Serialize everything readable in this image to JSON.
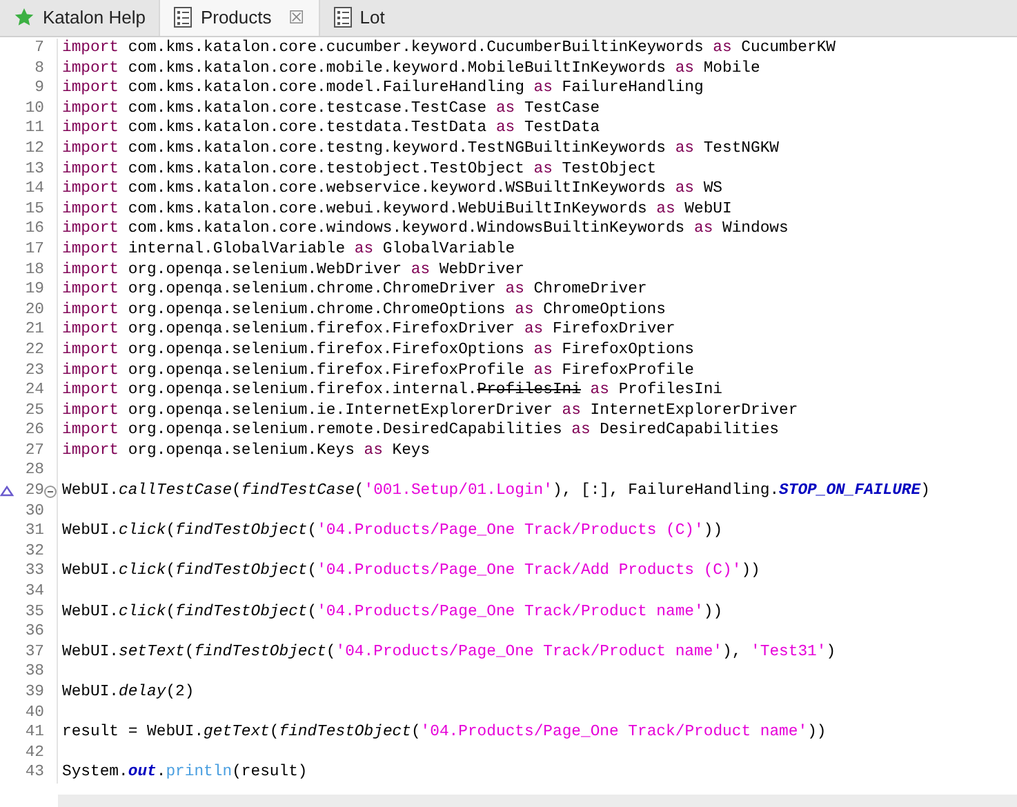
{
  "tabs": [
    {
      "label": "Katalon Help",
      "kind": "help",
      "selected": false,
      "closable": false
    },
    {
      "label": "Products",
      "kind": "document",
      "selected": true,
      "closable": true
    },
    {
      "label": "Lot",
      "kind": "document",
      "selected": false,
      "closable": false
    }
  ],
  "close_glyph": "☒",
  "editor": {
    "lines": [
      {
        "number": "7",
        "segments": [
          {
            "kind": "keyword",
            "text": "import"
          },
          {
            "kind": "plain",
            "text": " com.kms.katalon.core.cucumber.keyword.CucumberBuiltinKeywords "
          },
          {
            "kind": "keyword",
            "text": "as"
          },
          {
            "kind": "plain",
            "text": " CucumberKW"
          }
        ]
      },
      {
        "number": "8",
        "segments": [
          {
            "kind": "keyword",
            "text": "import"
          },
          {
            "kind": "plain",
            "text": " com.kms.katalon.core.mobile.keyword.MobileBuiltInKeywords "
          },
          {
            "kind": "keyword",
            "text": "as"
          },
          {
            "kind": "plain",
            "text": " Mobile"
          }
        ]
      },
      {
        "number": "9",
        "segments": [
          {
            "kind": "keyword",
            "text": "import"
          },
          {
            "kind": "plain",
            "text": " com.kms.katalon.core.model.FailureHandling "
          },
          {
            "kind": "keyword",
            "text": "as"
          },
          {
            "kind": "plain",
            "text": " FailureHandling"
          }
        ]
      },
      {
        "number": "10",
        "segments": [
          {
            "kind": "keyword",
            "text": "import"
          },
          {
            "kind": "plain",
            "text": " com.kms.katalon.core.testcase.TestCase "
          },
          {
            "kind": "keyword",
            "text": "as"
          },
          {
            "kind": "plain",
            "text": " TestCase"
          }
        ]
      },
      {
        "number": "11",
        "segments": [
          {
            "kind": "keyword",
            "text": "import"
          },
          {
            "kind": "plain",
            "text": " com.kms.katalon.core.testdata.TestData "
          },
          {
            "kind": "keyword",
            "text": "as"
          },
          {
            "kind": "plain",
            "text": " TestData"
          }
        ]
      },
      {
        "number": "12",
        "segments": [
          {
            "kind": "keyword",
            "text": "import"
          },
          {
            "kind": "plain",
            "text": " com.kms.katalon.core.testng.keyword.TestNGBuiltinKeywords "
          },
          {
            "kind": "keyword",
            "text": "as"
          },
          {
            "kind": "plain",
            "text": " TestNGKW"
          }
        ]
      },
      {
        "number": "13",
        "segments": [
          {
            "kind": "keyword",
            "text": "import"
          },
          {
            "kind": "plain",
            "text": " com.kms.katalon.core.testobject.TestObject "
          },
          {
            "kind": "keyword",
            "text": "as"
          },
          {
            "kind": "plain",
            "text": " TestObject"
          }
        ]
      },
      {
        "number": "14",
        "segments": [
          {
            "kind": "keyword",
            "text": "import"
          },
          {
            "kind": "plain",
            "text": " com.kms.katalon.core.webservice.keyword.WSBuiltInKeywords "
          },
          {
            "kind": "keyword",
            "text": "as"
          },
          {
            "kind": "plain",
            "text": " WS"
          }
        ]
      },
      {
        "number": "15",
        "segments": [
          {
            "kind": "keyword",
            "text": "import"
          },
          {
            "kind": "plain",
            "text": " com.kms.katalon.core.webui.keyword.WebUiBuiltInKeywords "
          },
          {
            "kind": "keyword",
            "text": "as"
          },
          {
            "kind": "plain",
            "text": " WebUI"
          }
        ]
      },
      {
        "number": "16",
        "segments": [
          {
            "kind": "keyword",
            "text": "import"
          },
          {
            "kind": "plain",
            "text": " com.kms.katalon.core.windows.keyword.WindowsBuiltinKeywords "
          },
          {
            "kind": "keyword",
            "text": "as"
          },
          {
            "kind": "plain",
            "text": " Windows"
          }
        ]
      },
      {
        "number": "17",
        "segments": [
          {
            "kind": "keyword",
            "text": "import"
          },
          {
            "kind": "plain",
            "text": " internal.GlobalVariable "
          },
          {
            "kind": "keyword",
            "text": "as"
          },
          {
            "kind": "plain",
            "text": " GlobalVariable"
          }
        ]
      },
      {
        "number": "18",
        "segments": [
          {
            "kind": "keyword",
            "text": "import"
          },
          {
            "kind": "plain",
            "text": " org.openqa.selenium.WebDriver "
          },
          {
            "kind": "keyword",
            "text": "as"
          },
          {
            "kind": "plain",
            "text": " WebDriver"
          }
        ]
      },
      {
        "number": "19",
        "segments": [
          {
            "kind": "keyword",
            "text": "import"
          },
          {
            "kind": "plain",
            "text": " org.openqa.selenium.chrome.ChromeDriver "
          },
          {
            "kind": "keyword",
            "text": "as"
          },
          {
            "kind": "plain",
            "text": " ChromeDriver"
          }
        ]
      },
      {
        "number": "20",
        "segments": [
          {
            "kind": "keyword",
            "text": "import"
          },
          {
            "kind": "plain",
            "text": " org.openqa.selenium.chrome.ChromeOptions "
          },
          {
            "kind": "keyword",
            "text": "as"
          },
          {
            "kind": "plain",
            "text": " ChromeOptions"
          }
        ]
      },
      {
        "number": "21",
        "segments": [
          {
            "kind": "keyword",
            "text": "import"
          },
          {
            "kind": "plain",
            "text": " org.openqa.selenium.firefox.FirefoxDriver "
          },
          {
            "kind": "keyword",
            "text": "as"
          },
          {
            "kind": "plain",
            "text": " FirefoxDriver"
          }
        ]
      },
      {
        "number": "22",
        "segments": [
          {
            "kind": "keyword",
            "text": "import"
          },
          {
            "kind": "plain",
            "text": " org.openqa.selenium.firefox.FirefoxOptions "
          },
          {
            "kind": "keyword",
            "text": "as"
          },
          {
            "kind": "plain",
            "text": " FirefoxOptions"
          }
        ]
      },
      {
        "number": "23",
        "segments": [
          {
            "kind": "keyword",
            "text": "import"
          },
          {
            "kind": "plain",
            "text": " org.openqa.selenium.firefox.FirefoxProfile "
          },
          {
            "kind": "keyword",
            "text": "as"
          },
          {
            "kind": "plain",
            "text": " FirefoxProfile"
          }
        ]
      },
      {
        "number": "24",
        "segments": [
          {
            "kind": "keyword",
            "text": "import"
          },
          {
            "kind": "plain",
            "text": " org.openqa.selenium.firefox.internal."
          },
          {
            "kind": "deprecated",
            "text": "ProfilesIni"
          },
          {
            "kind": "keyword",
            "text": " as"
          },
          {
            "kind": "plain",
            "text": " ProfilesIni"
          }
        ]
      },
      {
        "number": "25",
        "segments": [
          {
            "kind": "keyword",
            "text": "import"
          },
          {
            "kind": "plain",
            "text": " org.openqa.selenium.ie.InternetExplorerDriver "
          },
          {
            "kind": "keyword",
            "text": "as"
          },
          {
            "kind": "plain",
            "text": " InternetExplorerDriver"
          }
        ]
      },
      {
        "number": "26",
        "segments": [
          {
            "kind": "keyword",
            "text": "import"
          },
          {
            "kind": "plain",
            "text": " org.openqa.selenium.remote.DesiredCapabilities "
          },
          {
            "kind": "keyword",
            "text": "as"
          },
          {
            "kind": "plain",
            "text": " DesiredCapabilities"
          }
        ]
      },
      {
        "number": "27",
        "segments": [
          {
            "kind": "keyword",
            "text": "import"
          },
          {
            "kind": "plain",
            "text": " org.openqa.selenium.Keys "
          },
          {
            "kind": "keyword",
            "text": "as"
          },
          {
            "kind": "plain",
            "text": " Keys"
          }
        ]
      },
      {
        "number": "28"
      },
      {
        "number": "29",
        "override_marker": true,
        "fold_expanded": true,
        "segments": [
          {
            "kind": "plain",
            "text": "WebUI."
          },
          {
            "kind": "method",
            "text": "callTestCase"
          },
          {
            "kind": "plain",
            "text": "("
          },
          {
            "kind": "method",
            "text": "findTestCase"
          },
          {
            "kind": "plain",
            "text": "("
          },
          {
            "kind": "string",
            "text": "'001.Setup/01.Login'"
          },
          {
            "kind": "plain",
            "text": "), [:], FailureHandling."
          },
          {
            "kind": "constant",
            "text": "STOP_ON_FAILURE"
          },
          {
            "kind": "plain",
            "text": ")"
          }
        ]
      },
      {
        "number": "30"
      },
      {
        "number": "31",
        "segments": [
          {
            "kind": "plain",
            "text": "WebUI."
          },
          {
            "kind": "method",
            "text": "click"
          },
          {
            "kind": "plain",
            "text": "("
          },
          {
            "kind": "method",
            "text": "findTestObject"
          },
          {
            "kind": "plain",
            "text": "("
          },
          {
            "kind": "string",
            "text": "'04.Products/Page_One Track/Products (C)'"
          },
          {
            "kind": "plain",
            "text": "))"
          }
        ]
      },
      {
        "number": "32"
      },
      {
        "number": "33",
        "segments": [
          {
            "kind": "plain",
            "text": "WebUI."
          },
          {
            "kind": "method",
            "text": "click"
          },
          {
            "kind": "plain",
            "text": "("
          },
          {
            "kind": "method",
            "text": "findTestObject"
          },
          {
            "kind": "plain",
            "text": "("
          },
          {
            "kind": "string",
            "text": "'04.Products/Page_One Track/Add Products (C)'"
          },
          {
            "kind": "plain",
            "text": "))"
          }
        ]
      },
      {
        "number": "34"
      },
      {
        "number": "35",
        "segments": [
          {
            "kind": "plain",
            "text": "WebUI."
          },
          {
            "kind": "method",
            "text": "click"
          },
          {
            "kind": "plain",
            "text": "("
          },
          {
            "kind": "method",
            "text": "findTestObject"
          },
          {
            "kind": "plain",
            "text": "("
          },
          {
            "kind": "string",
            "text": "'04.Products/Page_One Track/Product name'"
          },
          {
            "kind": "plain",
            "text": "))"
          }
        ]
      },
      {
        "number": "36"
      },
      {
        "number": "37",
        "segments": [
          {
            "kind": "plain",
            "text": "WebUI."
          },
          {
            "kind": "method",
            "text": "setText"
          },
          {
            "kind": "plain",
            "text": "("
          },
          {
            "kind": "method",
            "text": "findTestObject"
          },
          {
            "kind": "plain",
            "text": "("
          },
          {
            "kind": "string",
            "text": "'04.Products/Page_One Track/Product name'"
          },
          {
            "kind": "plain",
            "text": "), "
          },
          {
            "kind": "string",
            "text": "'Test31'"
          },
          {
            "kind": "plain",
            "text": ")"
          }
        ]
      },
      {
        "number": "38"
      },
      {
        "number": "39",
        "segments": [
          {
            "kind": "plain",
            "text": "WebUI."
          },
          {
            "kind": "method",
            "text": "delay"
          },
          {
            "kind": "plain",
            "text": "(2)"
          }
        ]
      },
      {
        "number": "40"
      },
      {
        "number": "41",
        "segments": [
          {
            "kind": "plain",
            "text": "result = WebUI."
          },
          {
            "kind": "method",
            "text": "getText"
          },
          {
            "kind": "plain",
            "text": "("
          },
          {
            "kind": "method",
            "text": "findTestObject"
          },
          {
            "kind": "plain",
            "text": "("
          },
          {
            "kind": "string",
            "text": "'04.Products/Page_One Track/Product name'"
          },
          {
            "kind": "plain",
            "text": "))"
          }
        ]
      },
      {
        "number": "42"
      },
      {
        "number": "43",
        "segments": [
          {
            "kind": "plain",
            "text": "System."
          },
          {
            "kind": "field",
            "text": "out"
          },
          {
            "kind": "plain",
            "text": "."
          },
          {
            "kind": "call",
            "text": "println"
          },
          {
            "kind": "plain",
            "text": "(result)"
          }
        ]
      }
    ]
  }
}
